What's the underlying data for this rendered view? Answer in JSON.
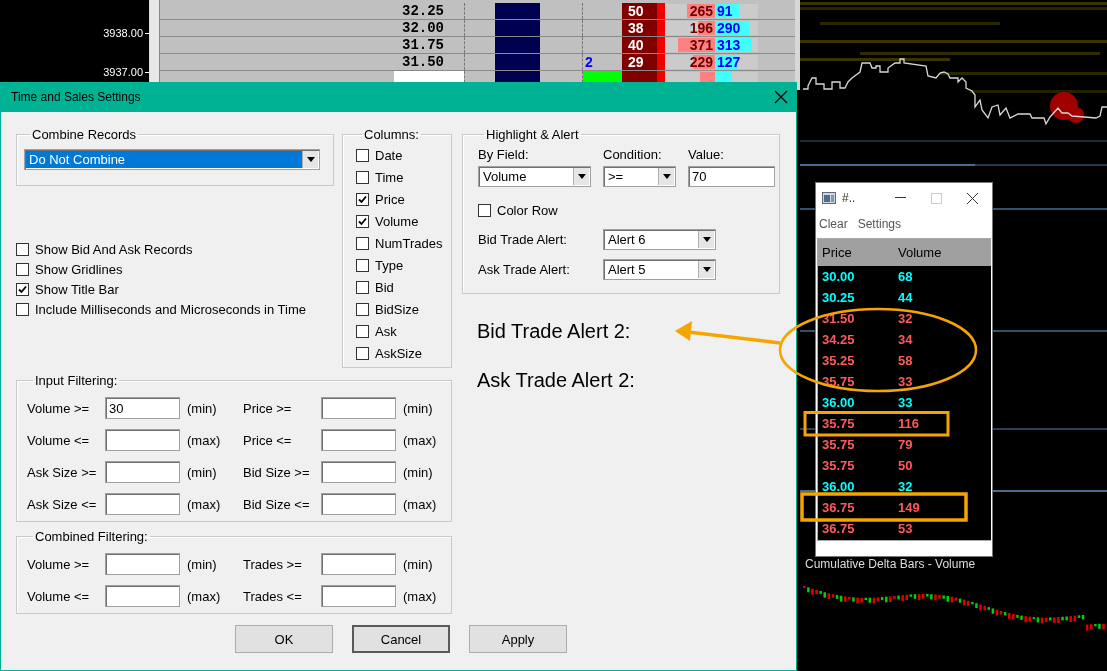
{
  "price_axis": {
    "labels": [
      "3938.00",
      "3937.00"
    ]
  },
  "ladder": {
    "rows": [
      {
        "price": "32.25",
        "current": false,
        "column_5": "50",
        "column_6": {
          "text": "265",
          "level": 0.56
        },
        "column_7": {
          "text": "91",
          "level": 0.55
        }
      },
      {
        "price": "32.00",
        "current": false,
        "column_5": "38",
        "column_6": {
          "text": "196",
          "level": 0.35
        },
        "column_7": {
          "text": "290",
          "level": 0.8
        }
      },
      {
        "price": "31.75",
        "current": false,
        "column_5": "40",
        "column_6": {
          "text": "371",
          "level": 0.75
        },
        "column_7": {
          "text": "313",
          "level": 0.85
        }
      },
      {
        "price": "31.50",
        "current": false,
        "column_4": {
          "text": "2"
        },
        "column_5": "29",
        "column_6": {
          "text": "229",
          "level": 0.45
        },
        "column_7": {
          "text": "127",
          "level": 0.5
        }
      },
      {
        "current": true,
        "column_4": {
          "color": "#00ff00"
        },
        "column_6": {
          "level": 0.3
        },
        "column_7": {
          "level": 0.4
        }
      }
    ]
  },
  "dialog": {
    "title": "Time and Sales Settings",
    "combine_records": {
      "label": "Combine Records",
      "value": "Do Not Combine"
    },
    "options": [
      {
        "label": "Show Bid And Ask Records",
        "checked": false
      },
      {
        "label": "Show Gridlines",
        "checked": false
      },
      {
        "label": "Show Title Bar",
        "checked": true
      },
      {
        "label": "Include Milliseconds and Microseconds in Time",
        "checked": false
      }
    ],
    "columns": {
      "label": "Columns:",
      "items": [
        {
          "label": "Date",
          "checked": false
        },
        {
          "label": "Time",
          "checked": false
        },
        {
          "label": "Price",
          "checked": true
        },
        {
          "label": "Volume",
          "checked": true
        },
        {
          "label": "NumTrades",
          "checked": false
        },
        {
          "label": "Type",
          "checked": false
        },
        {
          "label": "Bid",
          "checked": false
        },
        {
          "label": "BidSize",
          "checked": false
        },
        {
          "label": "Ask",
          "checked": false
        },
        {
          "label": "AskSize",
          "checked": false
        }
      ]
    },
    "highlight_alert": {
      "label": "Highlight & Alert",
      "by_field": {
        "label": "By Field:",
        "value": "Volume"
      },
      "condition": {
        "label": "Condition:",
        "value": ">="
      },
      "value": {
        "label": "Value:",
        "value": "70"
      },
      "color_row": {
        "label": "Color Row",
        "checked": false
      },
      "bid_trade_alert": {
        "label": "Bid Trade Alert:",
        "value": "Alert 6"
      },
      "ask_trade_alert": {
        "label": "Ask Trade Alert:",
        "value": "Alert 5"
      }
    },
    "notes": [
      "Bid Trade Alert 2:",
      "Ask Trade Alert 2:"
    ],
    "input_filtering": {
      "label": "Input Filtering:",
      "fields": [
        {
          "label": "Volume >=",
          "value": "30",
          "unit": "(min)"
        },
        {
          "label": "Price >=",
          "unit": "(min)"
        },
        {
          "label": "Volume <=",
          "unit": "(max)"
        },
        {
          "label": "Price <=",
          "unit": "(max)"
        },
        {
          "label": "Ask Size >=",
          "unit": "(min)"
        },
        {
          "label": "Bid Size >=",
          "unit": "(min)"
        },
        {
          "label": "Ask Size <=",
          "unit": "(max)"
        },
        {
          "label": "Bid Size <=",
          "unit": "(max)"
        }
      ]
    },
    "combined_filtering": {
      "label": "Combined Filtering:",
      "fields": [
        {
          "label": "Volume >=",
          "unit": "(min)"
        },
        {
          "label": "Trades >=",
          "unit": "(min)"
        },
        {
          "label": "Volume <=",
          "unit": "(max)"
        },
        {
          "label": "Trades <=",
          "unit": "(max)"
        }
      ]
    },
    "buttons": [
      "OK",
      "Cancel",
      "Apply"
    ]
  },
  "time_sales": {
    "title": "#..",
    "menu": [
      "Clear",
      "Settings"
    ],
    "columns": [
      "Price",
      "Volume"
    ],
    "rows": [
      {
        "price": "30.00",
        "volume": "68",
        "color": "#00ffff"
      },
      {
        "price": "30.25",
        "volume": "44",
        "color": "#00ffff"
      },
      {
        "price": "31.50",
        "volume": "32",
        "color": "#ff5a5a"
      },
      {
        "price": "34.25",
        "volume": "34",
        "color": "#ff5a5a"
      },
      {
        "price": "35.25",
        "volume": "58",
        "color": "#ff5a5a"
      },
      {
        "price": "35.75",
        "volume": "33",
        "color": "#ff5a5a"
      },
      {
        "price": "36.00",
        "volume": "33",
        "color": "#00ffff"
      },
      {
        "price": "35.75",
        "volume": "116",
        "color": "#ff5a5a"
      },
      {
        "price": "35.75",
        "volume": "79",
        "color": "#ff5a5a"
      },
      {
        "price": "35.75",
        "volume": "50",
        "color": "#ff5a5a"
      },
      {
        "price": "36.00",
        "volume": "32",
        "color": "#00ffff"
      },
      {
        "price": "36.75",
        "volume": "149",
        "color": "#ff5a5a"
      },
      {
        "price": "36.75",
        "volume": "53",
        "color": "#ff5a5a"
      }
    ]
  },
  "chart": {
    "title": "Cumulative Delta Bars - Volume"
  }
}
